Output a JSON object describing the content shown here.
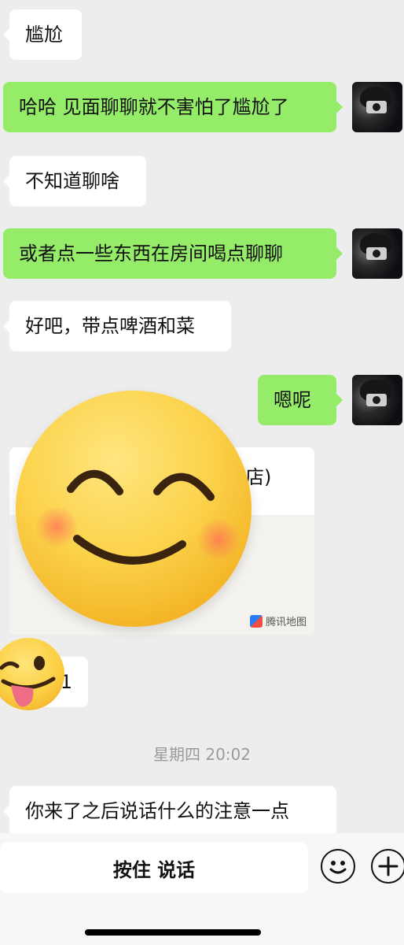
{
  "messages": [
    {
      "side": "in",
      "text": "尴尬"
    },
    {
      "side": "out",
      "text": "哈哈 见面聊聊就不害怕了尴尬了"
    },
    {
      "side": "in",
      "text": "不知道聊啥"
    },
    {
      "side": "out",
      "text": "或者点一些东西在房间喝点聊聊"
    },
    {
      "side": "in",
      "text": "好吧，带点啤酒和菜"
    },
    {
      "side": "out",
      "text": "嗯呢"
    },
    {
      "side": "in",
      "text": "1"
    },
    {
      "side": "in",
      "text": "你来了之后说话什么的注意一点"
    }
  ],
  "location_card": {
    "title_fragment": "店)",
    "brand": "腾讯地图"
  },
  "timestamp": "星期四 20:02",
  "input_bar": {
    "talk_label": "按住 说话",
    "emoji_icon": "smiley-icon",
    "plus_icon": "plus-icon"
  },
  "colors": {
    "background": "#ededed",
    "outgoing_bubble": "#95ec69",
    "incoming_bubble": "#ffffff"
  }
}
